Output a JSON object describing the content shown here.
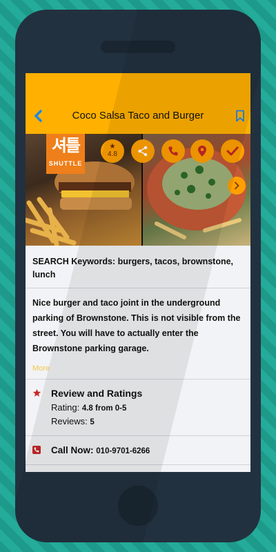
{
  "appbar": {
    "title": "Coco Salsa Taco and Burger",
    "back_icon": "chevron-left-icon",
    "bookmark_icon": "bookmark-icon"
  },
  "photos": {
    "logo_mark": "셔틀",
    "logo_word": "SHUTTLE",
    "rating": "4.8",
    "actions": [
      "share-icon",
      "phone-icon",
      "map-pin-icon",
      "check-icon"
    ],
    "next_icon": "chevron-right-icon"
  },
  "keywords": {
    "text": "SEARCH Keywords: burgers, tacos, brownstone, lunch"
  },
  "description": {
    "text": "Nice burger and taco joint in the underground parking of Brownstone. This is not visible from the street. You will have to actually enter the Brownstone parking garage.",
    "more_label": "More"
  },
  "reviews": {
    "heading": "Review and Ratings",
    "rating_label": "Rating:",
    "rating_value": "4.8 from 0-5",
    "reviews_label": "Reviews:",
    "reviews_value": "5"
  },
  "call": {
    "label": "Call Now:",
    "number": "010-9701-6266"
  },
  "colors": {
    "accent": "#ffb000",
    "button": "#ffa000",
    "icon_red": "#c62828",
    "more_link": "#f5c64a",
    "back_icon": "#1e88e5"
  }
}
